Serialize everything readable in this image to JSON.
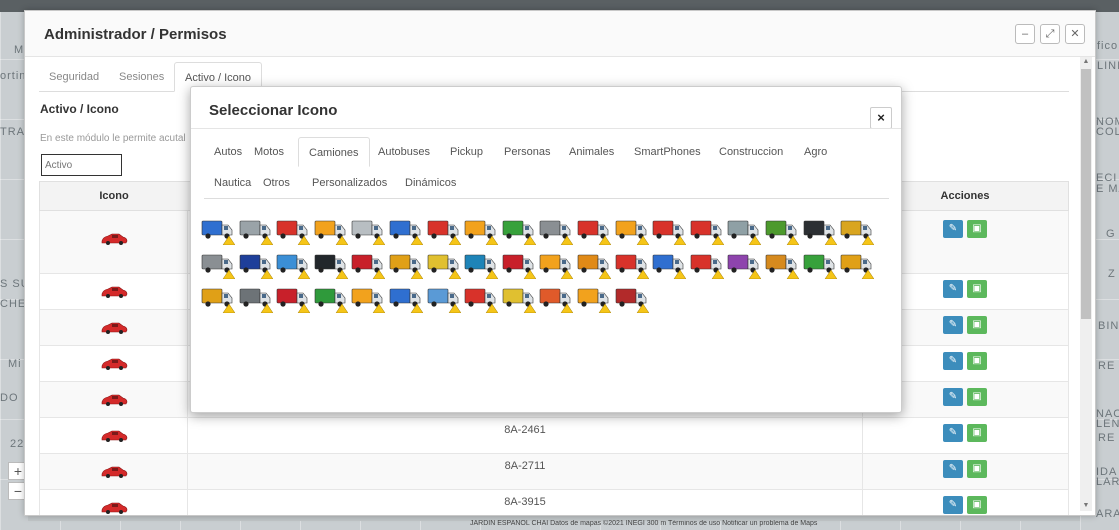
{
  "map": {
    "labels": [
      "M",
      "ortines",
      "TRA",
      "S SU",
      "CHEI",
      "Mi",
      "DO",
      "LINI",
      "NOM",
      "COL",
      "ECI",
      "E MA",
      "G",
      "Z",
      "BIN",
      "RE",
      "NACI",
      "LENI",
      "RE",
      "IDA",
      "LAR",
      "ARA",
      "fico",
      "22"
    ],
    "street_footer": "JARDIN ESPAÑOL   CHAI  Datos de mapas ©2021 INEGI   300 m   Términos de uso   Notificar un problema de Maps"
  },
  "admin": {
    "title": "Administrador / Permisos",
    "window_buttons": {
      "minimize": "–",
      "restore": "⤢",
      "close": "✕"
    },
    "tabs": [
      {
        "label": "Seguridad",
        "active": false
      },
      {
        "label": "Sesiones",
        "active": false
      },
      {
        "label": "Activo / Icono",
        "active": true
      }
    ],
    "section_title": "Activo / Icono",
    "section_desc": "En este módulo le permite acutal",
    "filter_placeholder": "Activo",
    "grid": {
      "col_icon": "Icono",
      "col_actions": "Acciones",
      "rows": [
        {
          "plate": ""
        },
        {
          "plate": ""
        },
        {
          "plate": ""
        },
        {
          "plate": ""
        },
        {
          "plate": ""
        },
        {
          "plate": "8A-2461"
        },
        {
          "plate": "8A-2711"
        },
        {
          "plate": "8A-3915"
        }
      ]
    }
  },
  "modal": {
    "title": "Seleccionar Icono",
    "close": "×",
    "tabs": [
      {
        "label": "Autos",
        "active": false
      },
      {
        "label": "Motos",
        "active": false
      },
      {
        "label": "Camiones",
        "active": true
      },
      {
        "label": "Autobuses",
        "active": false
      },
      {
        "label": "Pickup",
        "active": false
      },
      {
        "label": "Personas",
        "active": false
      },
      {
        "label": "Animales",
        "active": false
      },
      {
        "label": "SmartPhones",
        "active": false
      },
      {
        "label": "Construccion",
        "active": false
      },
      {
        "label": "Agro",
        "active": false
      },
      {
        "label": "Nautica",
        "active": false
      },
      {
        "label": "Otros",
        "active": false
      },
      {
        "label": "Personalizados",
        "active": false
      },
      {
        "label": "Dinámicos",
        "active": false
      }
    ],
    "truck_colors": [
      "#2f6fd0",
      "#9aa3a8",
      "#d8322a",
      "#f2a21d",
      "#b8bec2",
      "#2f6fd0",
      "#d8322a",
      "#f2a21d",
      "#37a13b",
      "#8a8f93",
      "#d8322a",
      "#f2a21d",
      "#d8322a",
      "#d8322a",
      "#8fa0a5",
      "#4d9a2d",
      "#2c2f33",
      "#d9a520",
      "#8a8f93",
      "#1e3f9a",
      "#3b8fd6",
      "#22272b",
      "#c8202a",
      "#e0a017",
      "#e0c030",
      "#1e84b8",
      "#c8202a",
      "#f2a21d",
      "#e08a17",
      "#d8322a",
      "#2f6fd0",
      "#d8322a",
      "#8e44ad",
      "#d68a1e",
      "#37a13b",
      "#e0a017",
      "#e0a017",
      "#6d7377",
      "#c8202a",
      "#2f9a3b",
      "#f2a21d",
      "#2f6fd0",
      "#5a9ad6",
      "#d8322a",
      "#e0c030",
      "#e05a2a",
      "#f2a21d",
      "#b22a2a"
    ]
  }
}
